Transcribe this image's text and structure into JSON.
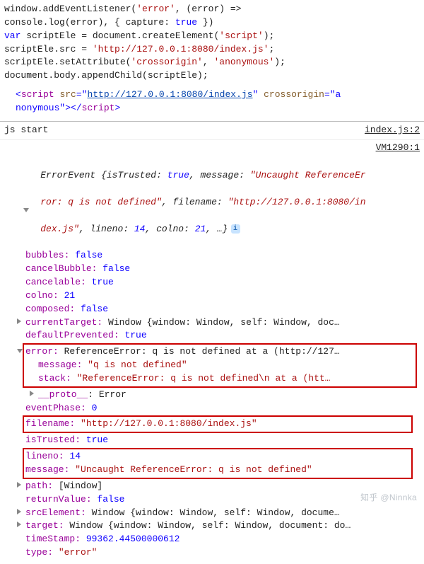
{
  "code_top": {
    "l1a": "window.addEventListener(",
    "l1b": "'error'",
    "l1c": ", (error) =>",
    "l2a": "console.log(error), { capture: ",
    "l2b": "true",
    "l2c": " })",
    "l3a": "var",
    "l3b": " scriptEle = document.createElement(",
    "l3c": "'script'",
    "l3d": ");",
    "l4a": "scriptEle.src = ",
    "l4b": "'http://127.0.0.1:8080/index.js'",
    "l4c": ";",
    "l5a": "scriptEle.setAttribute(",
    "l5b": "'crossorigin'",
    "l5c": ", ",
    "l5d": "'anonymous'",
    "l5e": ");",
    "l6": "document.body.appendChild(scriptEle);"
  },
  "elements": {
    "open1": "<",
    "tag": "script",
    "attr_src": "src",
    "eq": "=\"",
    "src_url": "http://127.0.0.1:8080/index.js",
    "q2": "\" ",
    "attr_co": "crossorigin",
    "co_val": "=\"",
    "anon_a": "a",
    "anon_rest": "nonymous",
    "q3": "\">",
    "close1": "</",
    "close2": ">"
  },
  "console1": {
    "msg": "js start",
    "src": "index.js:2"
  },
  "vm_label": "VM1290:1",
  "obj_header": {
    "name": "ErrorEvent ",
    "brace": "{",
    "p1k": "isTrusted: ",
    "p1v": "true",
    "sep": ", ",
    "p2k": "message: ",
    "p2v": "\"Uncaught ReferenceEr",
    "p3_wrap_a": "ror: q is not defined\"",
    "p3k": "filename: ",
    "p3v": "\"http://127.0.0.1:8080/in",
    "p3_wrap_b": "dex.js\"",
    "p4k": "lineno: ",
    "p4v": "14",
    "p5k": "colno: ",
    "p5v": "21",
    "ell": ", …}"
  },
  "props": {
    "bubbles_k": "bubbles: ",
    "bubbles_v": "false",
    "cancelBubble_k": "cancelBubble: ",
    "cancelBubble_v": "false",
    "cancelable_k": "cancelable: ",
    "cancelable_v": "true",
    "colno_k": "colno: ",
    "colno_v": "21",
    "composed_k": "composed: ",
    "composed_v": "false",
    "currentTarget_k": "currentTarget: ",
    "currentTarget_v": "Window {window: Window, self: Window, doc…",
    "defaultPrevented_k": "defaultPrevented: ",
    "defaultPrevented_v": "true",
    "error_k": "error: ",
    "error_v": "ReferenceError: q is not defined at a (http://127…",
    "err_message_k": "message: ",
    "err_message_v": "\"q is not defined\"",
    "err_stack_k": "stack: ",
    "err_stack_v": "\"ReferenceError: q is not defined\\n    at a (htt…",
    "err_proto_k": "__proto__",
    "err_proto_v": ": Error",
    "eventPhase_k": "eventPhase: ",
    "eventPhase_v": "0",
    "filename_k": "filename: ",
    "filename_v": "\"http://127.0.0.1:8080/index.js\"",
    "isTrusted_k": "isTrusted: ",
    "isTrusted_v": "true",
    "lineno_k": "lineno: ",
    "lineno_v": "14",
    "message_k": "message: ",
    "message_v": "\"Uncaught ReferenceError: q is not defined\"",
    "path_k": "path: ",
    "path_v": "[Window]",
    "returnValue_k": "returnValue: ",
    "returnValue_v": "false",
    "srcElement_k": "srcElement: ",
    "srcElement_v": "Window {window: Window, self: Window, docume…",
    "target_k": "target: ",
    "target_v": "Window {window: Window, self: Window, document: do…",
    "timeStamp_k": "timeStamp: ",
    "timeStamp_v": "99362.44500000612",
    "type_k": "type: ",
    "type_v": "\"error\""
  },
  "watermark": "知乎 @Ninnka"
}
